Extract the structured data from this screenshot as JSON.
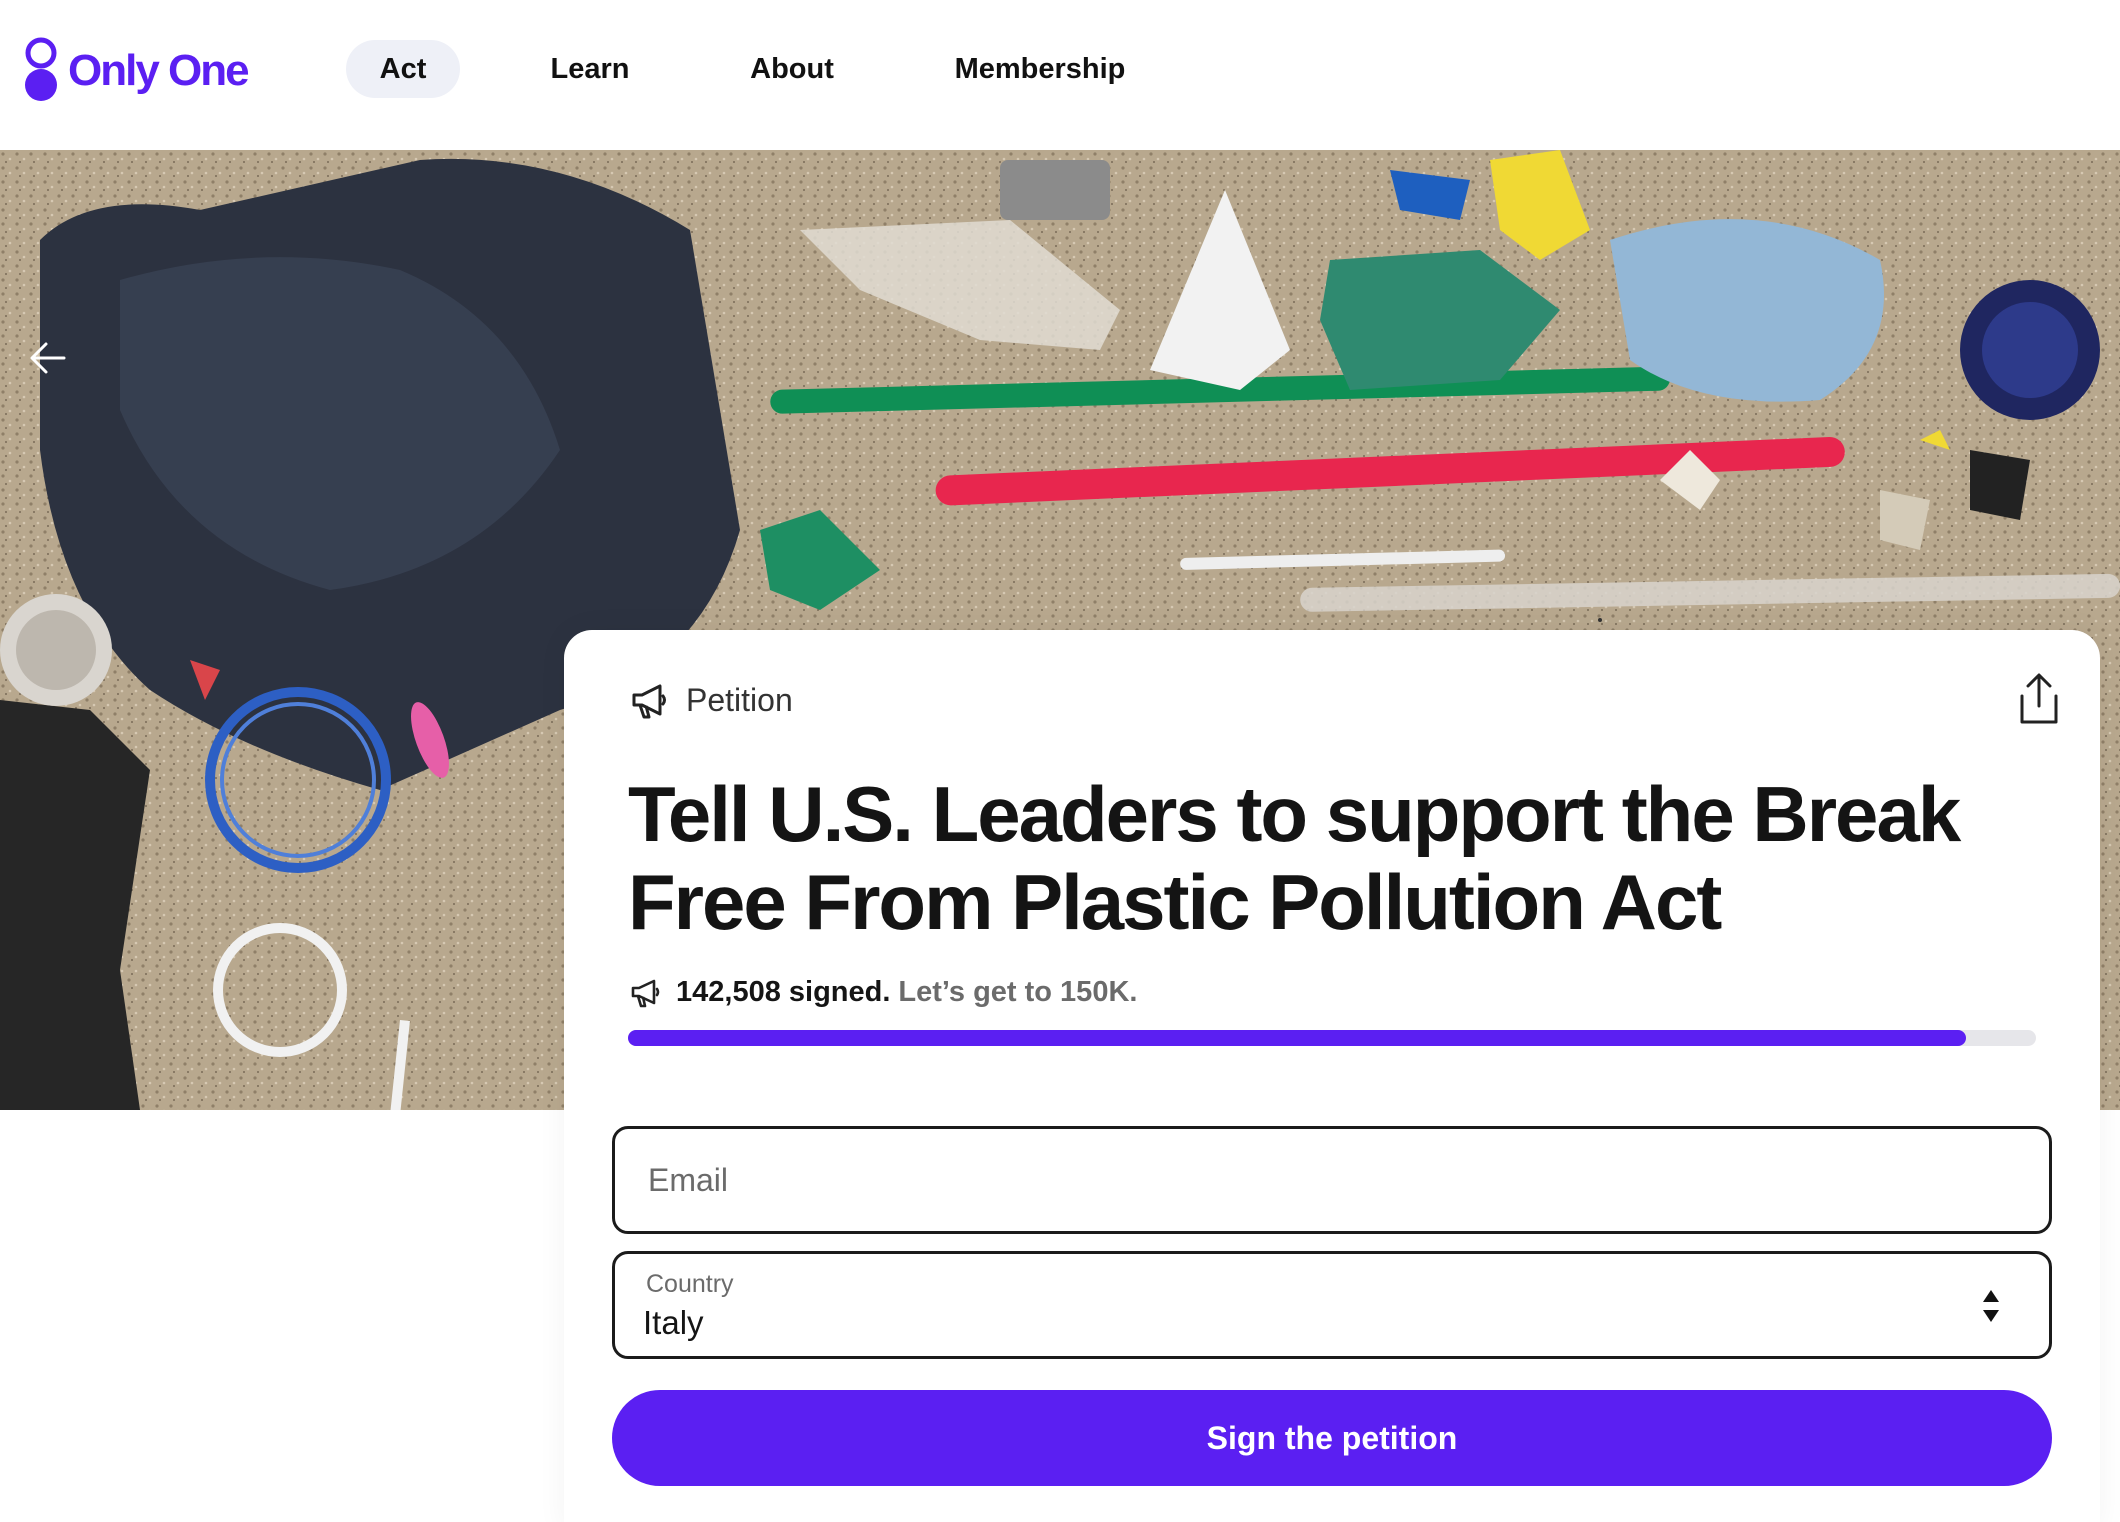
{
  "brand": {
    "name": "Only One",
    "color": "#5b1ff2"
  },
  "nav": {
    "items": [
      {
        "label": "Act",
        "active": true
      },
      {
        "label": "Learn",
        "active": false
      },
      {
        "label": "About",
        "active": false
      },
      {
        "label": "Membership",
        "active": false
      }
    ]
  },
  "hero": {
    "back_icon": "arrow-left-icon"
  },
  "card": {
    "type_label": "Petition",
    "type_icon": "megaphone-icon",
    "share_icon": "share-icon",
    "title": "Tell U.S. Leaders to support the Break Free From Plastic Pollution Act",
    "signed_text": "142,508 signed.",
    "goal_text": "Let’s get to 150K.",
    "signed": 142508,
    "goal": 150000,
    "progress_color": "#5b1ff2"
  },
  "form": {
    "email": {
      "placeholder": "Email",
      "value": ""
    },
    "country": {
      "label": "Country",
      "value": "Italy"
    },
    "submit_label": "Sign the petition"
  }
}
